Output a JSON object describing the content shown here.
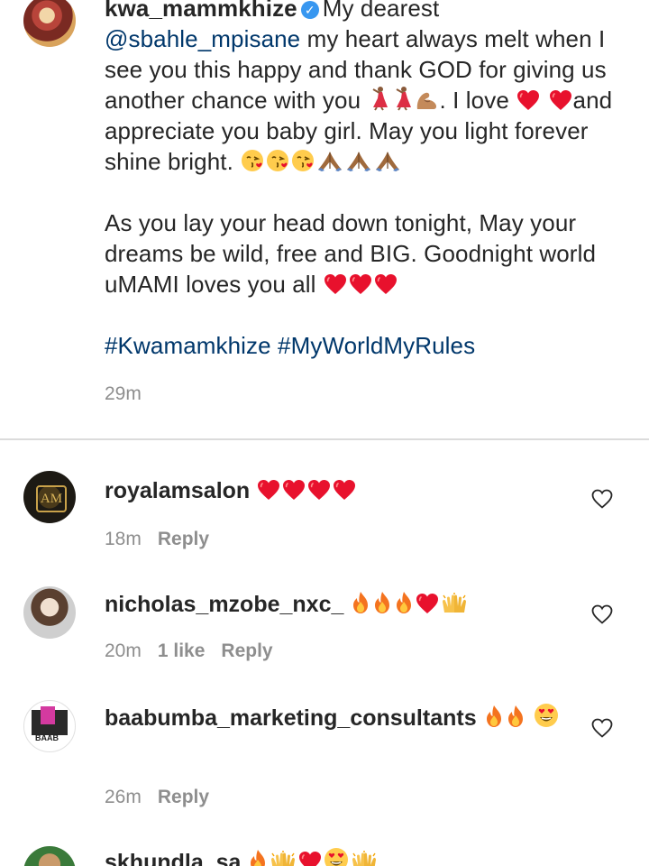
{
  "caption": {
    "username": "kwa_mammkhize",
    "verified": "✓",
    "line_intro": "My dearest",
    "mention": "@sbahle_mpisane",
    "p1_a": " my heart always melt when I see you this happy and thank GOD for giving us another chance with you ",
    "p1_b": ". I love ",
    "p1_c": "and appreciate you baby girl. May you light forever shine bright. ",
    "p2": "As you lay your head down tonight, May your dreams be wild, free and BIG. Goodnight world uMAMI loves you all ",
    "hashtags": "#Kwamamkhize #MyWorldMyRules",
    "time": "29m"
  },
  "comments": [
    {
      "username": "royalamsalon",
      "avatar_text": "AM",
      "time": "18m",
      "likes": "",
      "reply": "Reply"
    },
    {
      "username": "nicholas_mzobe_nxc_",
      "time": "20m",
      "likes": "1 like",
      "reply": "Reply"
    },
    {
      "username": "baabumba_marketing_consultants",
      "avatar_text": "BAAB",
      "time": "26m",
      "likes": "",
      "reply": "Reply"
    },
    {
      "username": "skhundla_sa"
    }
  ],
  "colors": {
    "link": "#00376b",
    "meta": "#8e8e8e",
    "heart": "#e8112d",
    "verified": "#3897f0"
  }
}
